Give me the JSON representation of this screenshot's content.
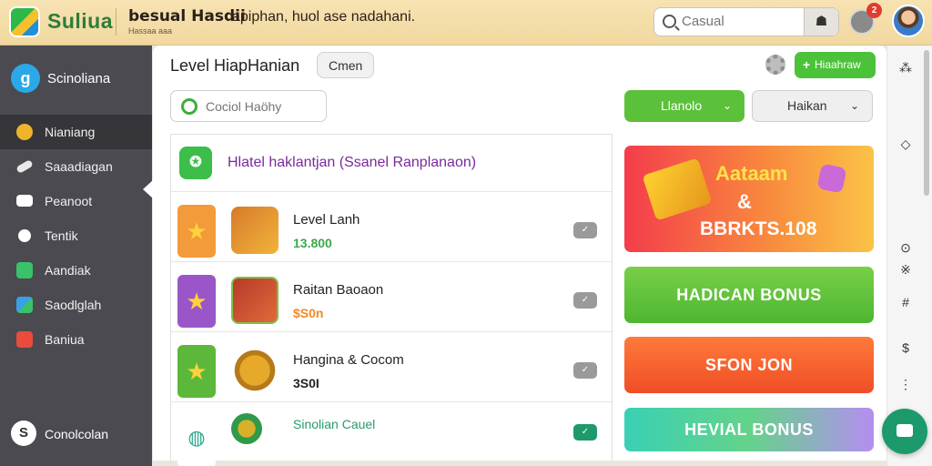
{
  "header": {
    "logo_text": "Suliua",
    "title": "besual Hasdii",
    "subtitle": "Hassaa aaa",
    "message": "apiphan, huol ase nadahani.",
    "search_placeholder": "Casual",
    "notification_count": "2"
  },
  "sidebar": {
    "brand": "Scinoliana",
    "items": [
      {
        "label": "Nianiang",
        "icon": "coin-icon",
        "color": "#f0b42a"
      },
      {
        "label": "Saaadiagan",
        "icon": "rocket-icon",
        "color": "#e8e8e8"
      },
      {
        "label": "Peanoot",
        "icon": "mail-icon",
        "color": "#ffffff"
      },
      {
        "label": "Tentik",
        "icon": "chat-icon",
        "color": "#ffffff"
      },
      {
        "label": "Aandiak",
        "icon": "gamepad-icon",
        "color": "#39c26a"
      },
      {
        "label": "Saodlglah",
        "icon": "controller-icon",
        "color": "#3aa0e8"
      },
      {
        "label": "Baniua",
        "icon": "gift-icon",
        "color": "#e94b3c"
      }
    ],
    "bottom_label": "Conolcolan"
  },
  "main": {
    "title": "Level HiapHanian",
    "chip": "Cmen",
    "top_button": "Hiaahraw",
    "filter_placeholder": "Cociol Haöhy",
    "dropdown_primary": "Llanolo",
    "dropdown_secondary": "Haikan",
    "list_header": "Hlatel haklantjan (Ssanel Ranplanaon)",
    "rows": [
      {
        "title": "Level Lanh",
        "value": "13.800",
        "value_color": "#3aa84a",
        "badge_bg": "#f39a3a"
      },
      {
        "title": "Raitan Baoaon",
        "value": "$S0n",
        "value_color": "#f08a24",
        "badge_bg": "#9a56c8"
      },
      {
        "title": "Hangina & Cocom",
        "value": "3S0I",
        "value_color": "#222222",
        "badge_bg": "#5cb83a"
      },
      {
        "title": "Sinolian Cauel",
        "value": "",
        "value_color": "#222222",
        "badge_bg": "#ffffff"
      }
    ],
    "promos": {
      "big_line1": "Aataam",
      "big_line2": "&",
      "big_line3": "BBRKTS.108",
      "button2": "HADICAN BONUS",
      "button3": "SFON JON",
      "button4": "HEVIAL BONUS"
    }
  },
  "colors": {
    "accent_green": "#4cc23a",
    "sidebar_bg": "#4a4a50",
    "topbar_bg": "#f1d89f"
  }
}
